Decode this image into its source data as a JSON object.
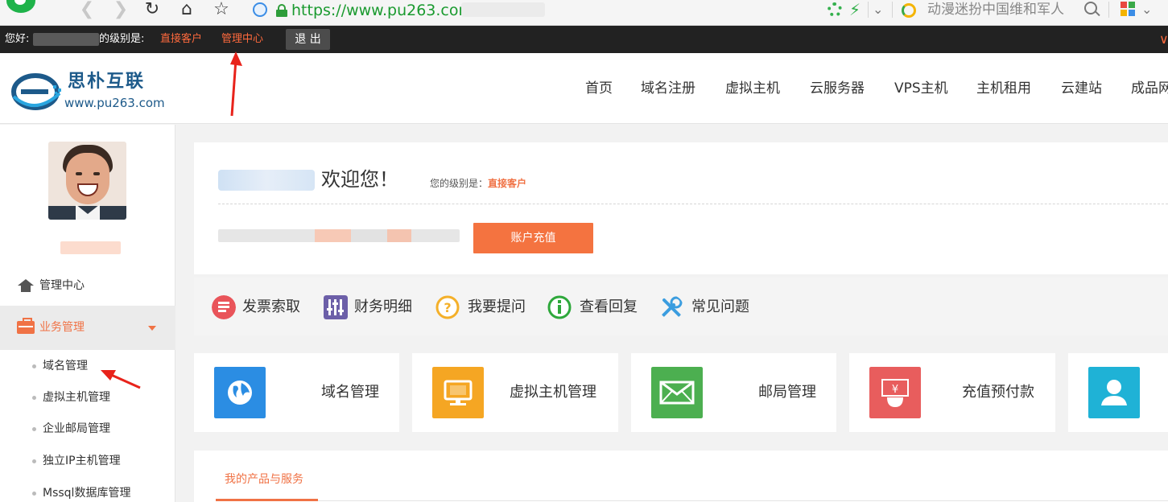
{
  "browser": {
    "url": "https://www.pu263.com",
    "search_text": "动漫迷扮中国维和军人"
  },
  "account_bar": {
    "greeting": "您好:",
    "level_prefix": "的级别是:",
    "level_value": "直接客户",
    "center_link": "管理中心",
    "logout_label": "退 出"
  },
  "brand": {
    "name": "思朴互联",
    "url": "www.pu263.com"
  },
  "main_nav": [
    "首页",
    "域名注册",
    "虚拟主机",
    "云服务器",
    "VPS主机",
    "主机租用",
    "云建站",
    "成品网"
  ],
  "sidebar": {
    "home_label": "管理中心",
    "business_label": "业务管理",
    "sub_items": [
      "域名管理",
      "虚拟主机管理",
      "企业邮局管理",
      "独立IP主机管理",
      "Mssql数据库管理"
    ]
  },
  "welcome": {
    "greeting": "欢迎您！",
    "level_prefix": "您的级别是：",
    "level_value": "直接客户",
    "recharge_label": "账户充值"
  },
  "quick_links": [
    "发票索取",
    "财务明细",
    "我要提问",
    "查看回复",
    "常见问题"
  ],
  "tiles": [
    "域名管理",
    "虚拟主机管理",
    "邮局管理",
    "充值预付款"
  ],
  "products": {
    "tab_label": "我的产品与服务"
  },
  "colors": {
    "accent": "#f07245",
    "dark_bar": "#222222",
    "tile_domain": "#2b8de3",
    "tile_host": "#f5a623",
    "tile_mail": "#4caf50",
    "tile_recharge": "#e85d5d",
    "tile_user": "#1fb2d6"
  }
}
